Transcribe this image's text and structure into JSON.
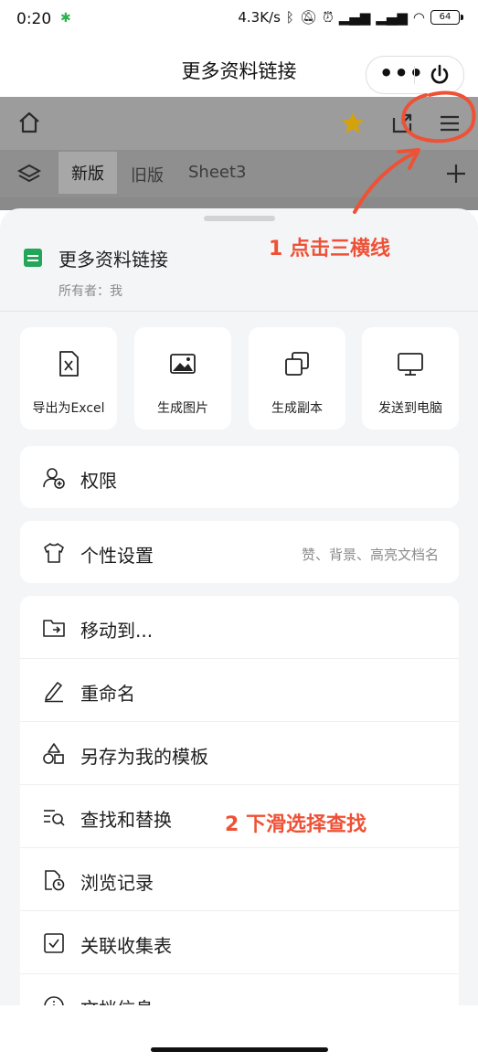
{
  "status_bar": {
    "time": "0:20",
    "network_speed": "4.3K/s",
    "battery": "64"
  },
  "header": {
    "title": "更多资料链接",
    "more_label": "•••"
  },
  "toolbar": {
    "tabs": [
      "新版",
      "旧版",
      "Sheet3"
    ]
  },
  "sheet": {
    "doc_title": "更多资料链接",
    "owner": "所有者：我",
    "actions": [
      {
        "label": "导出为Excel",
        "icon": "excel-icon"
      },
      {
        "label": "生成图片",
        "icon": "image-icon"
      },
      {
        "label": "生成副本",
        "icon": "copy-icon"
      },
      {
        "label": "发送到电脑",
        "icon": "monitor-icon"
      }
    ],
    "permission_label": "权限",
    "personalize": {
      "label": "个性设置",
      "hint": "赞、背景、高亮文档名"
    },
    "menu": [
      {
        "label": "移动到...",
        "icon": "folder-move-icon"
      },
      {
        "label": "重命名",
        "icon": "pencil-icon"
      },
      {
        "label": "另存为我的模板",
        "icon": "template-icon"
      },
      {
        "label": "查找和替换",
        "icon": "find-replace-icon"
      },
      {
        "label": "浏览记录",
        "icon": "history-icon"
      },
      {
        "label": "关联收集表",
        "icon": "form-link-icon"
      },
      {
        "label": "文档信息",
        "icon": "info-icon"
      }
    ]
  },
  "annotations": {
    "step1": "1 点击三横线",
    "step2": "2 下滑选择查找"
  },
  "colors": {
    "accent_red": "#ee5136",
    "star": "#d4a20b",
    "sheet_bg": "#f4f5f7"
  }
}
